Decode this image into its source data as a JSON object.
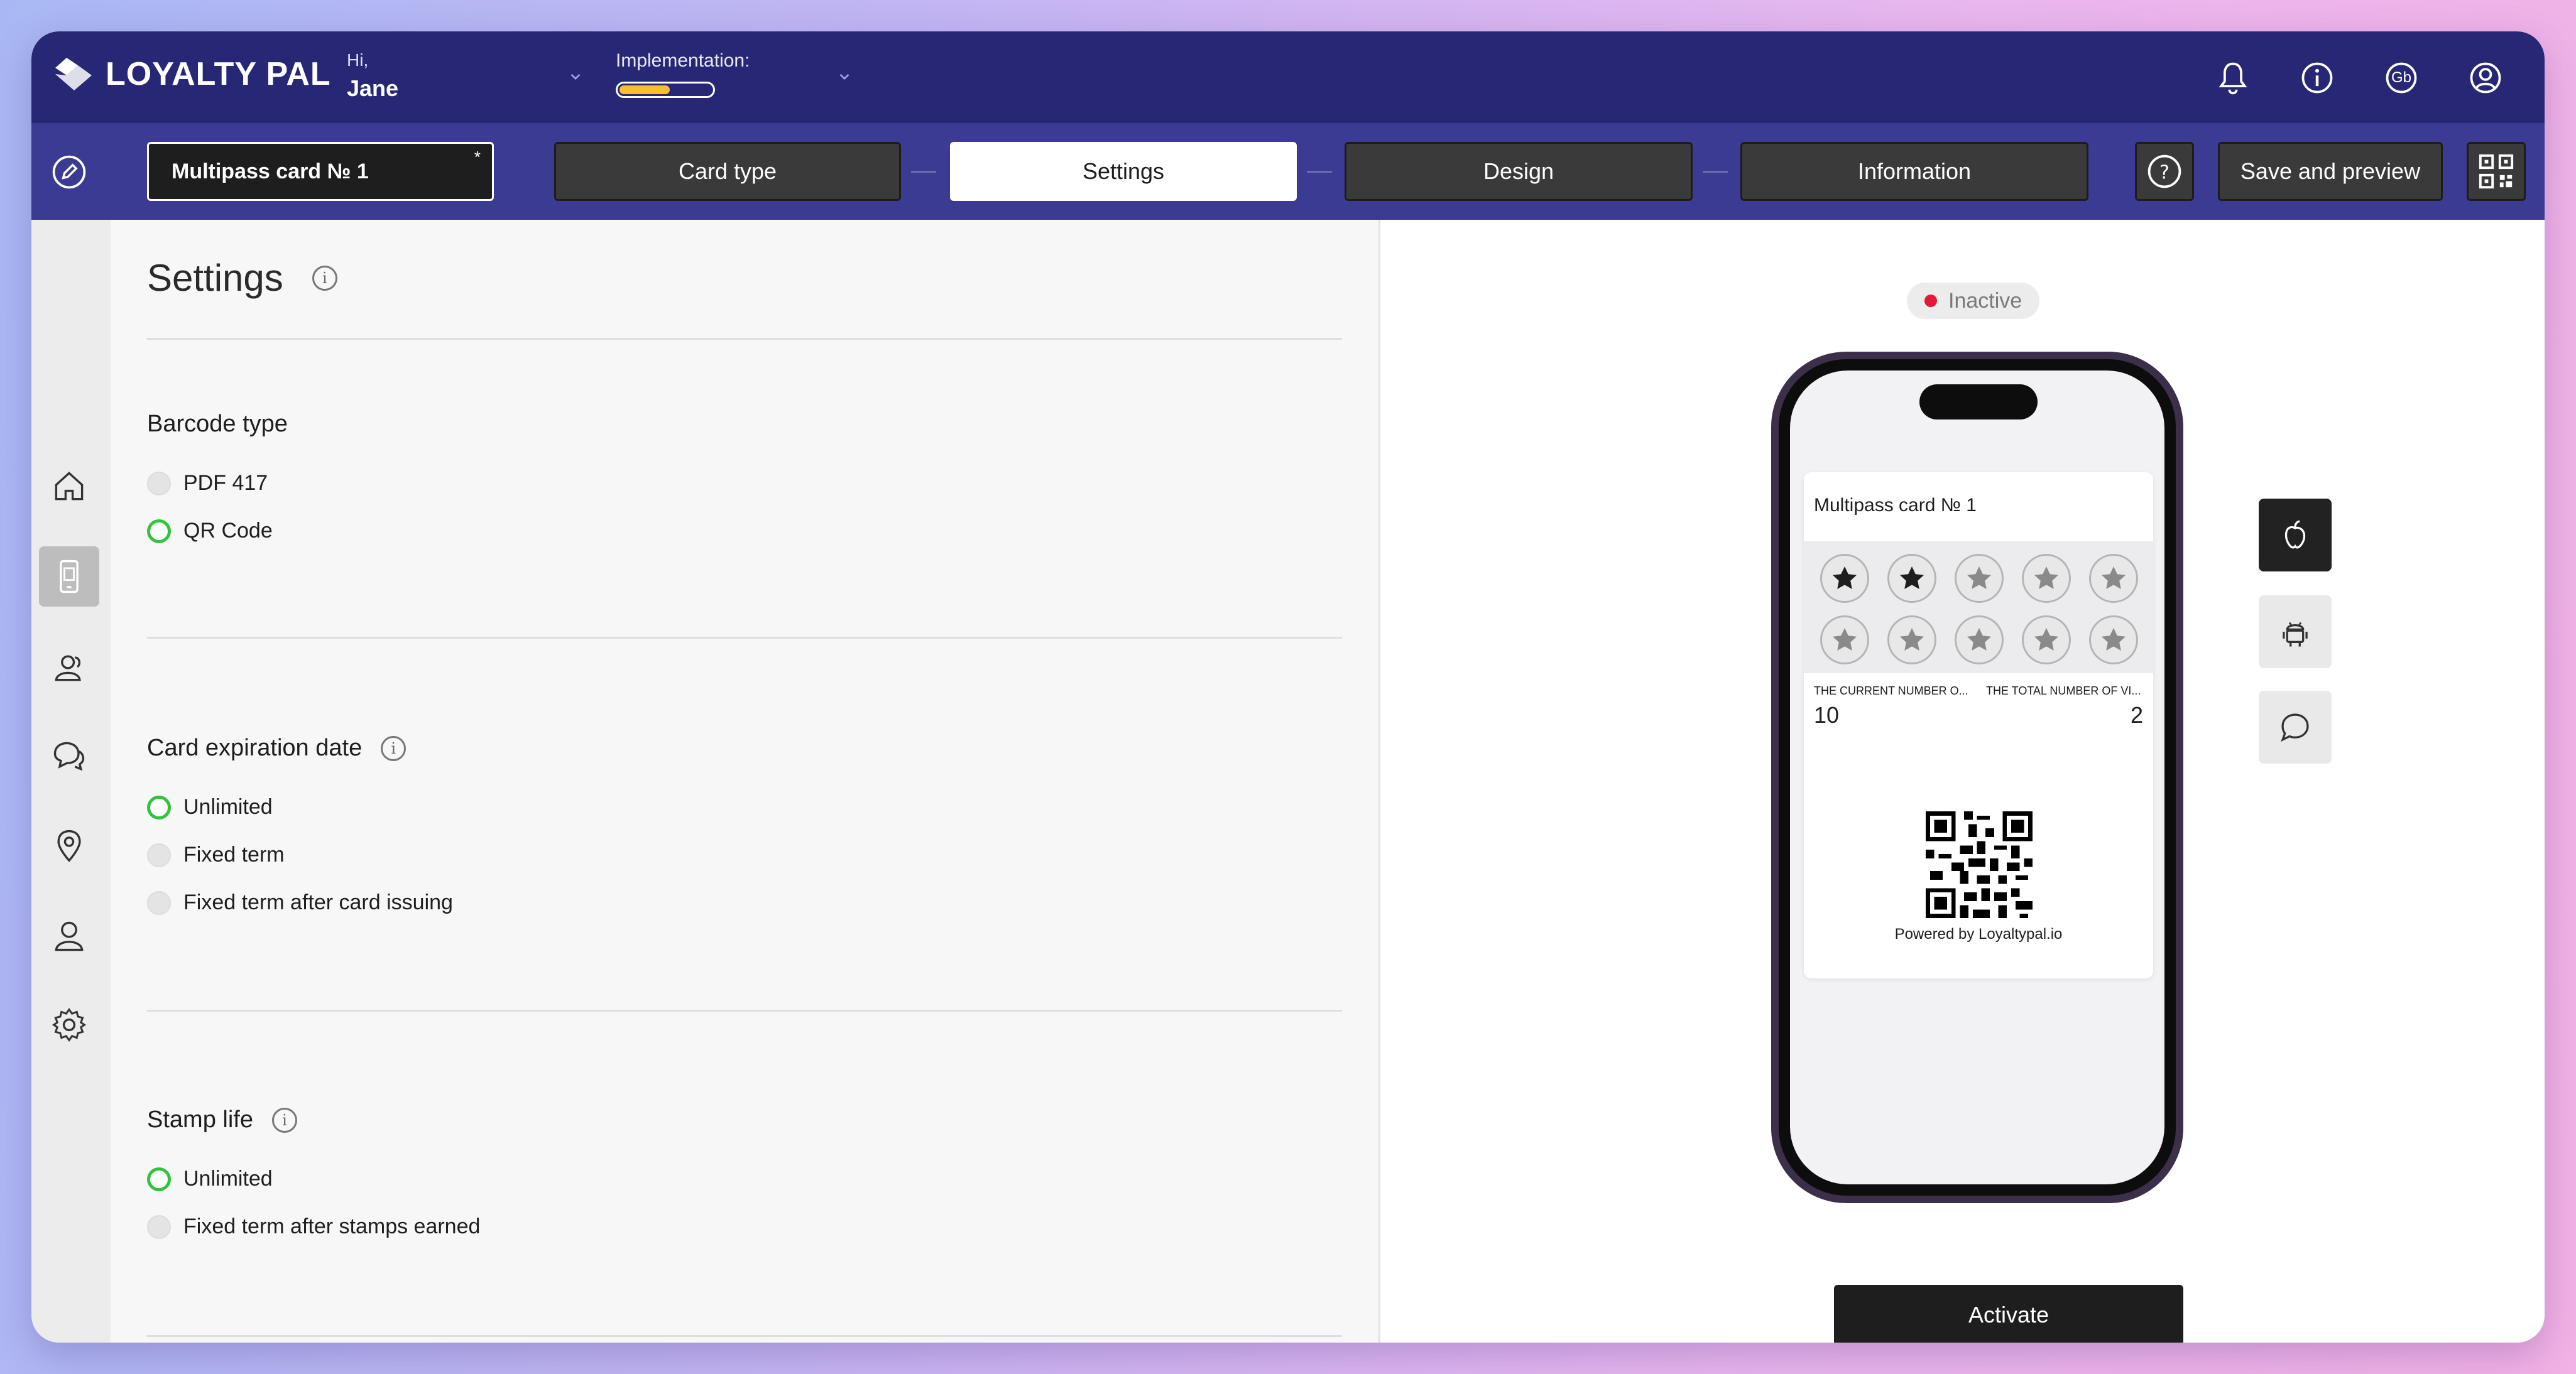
{
  "header": {
    "logo_text": "LOYALTY PAL",
    "greeting": "Hi,",
    "user_name": "Jane",
    "implementation_label": "Implementation:",
    "implementation_progress": 0.55,
    "language_badge": "Gb"
  },
  "steps": {
    "card_name": "Multipass card № 1",
    "required_mark": "*",
    "items": [
      "Card type",
      "Settings",
      "Design",
      "Information"
    ],
    "active": "Settings",
    "help_label": "?",
    "save_label": "Save and preview"
  },
  "settings": {
    "title": "Settings",
    "info_glyph": "i",
    "barcode": {
      "title": "Barcode type",
      "options": [
        "PDF 417",
        "QR Code"
      ],
      "selected": "QR Code"
    },
    "expiration": {
      "title": "Card expiration date",
      "options": [
        "Unlimited",
        "Fixed term",
        "Fixed term after card issuing"
      ],
      "selected": "Unlimited"
    },
    "stamp_life": {
      "title": "Stamp life",
      "options": [
        "Unlimited",
        "Fixed term after stamps earned"
      ],
      "selected": "Unlimited"
    }
  },
  "preview": {
    "status": "Inactive",
    "status_color": "#e3183b",
    "card_title": "Multipass card № 1",
    "stamps_total": 10,
    "stamps_filled": 2,
    "field1_label": "THE CURRENT NUMBER O...",
    "field1_value": "10",
    "field2_label": "THE TOTAL NUMBER OF VI...",
    "field2_value": "2",
    "powered_by": "Powered by Loyaltypal.io",
    "activate_label": "Activate",
    "platforms": [
      "apple-icon",
      "android-icon",
      "chat-icon"
    ]
  },
  "colors": {
    "header_bg": "#272775",
    "stepbar_bg": "#3b3b93",
    "radio_on": "#2fc43a",
    "progress_fill": "#f5c02b"
  }
}
